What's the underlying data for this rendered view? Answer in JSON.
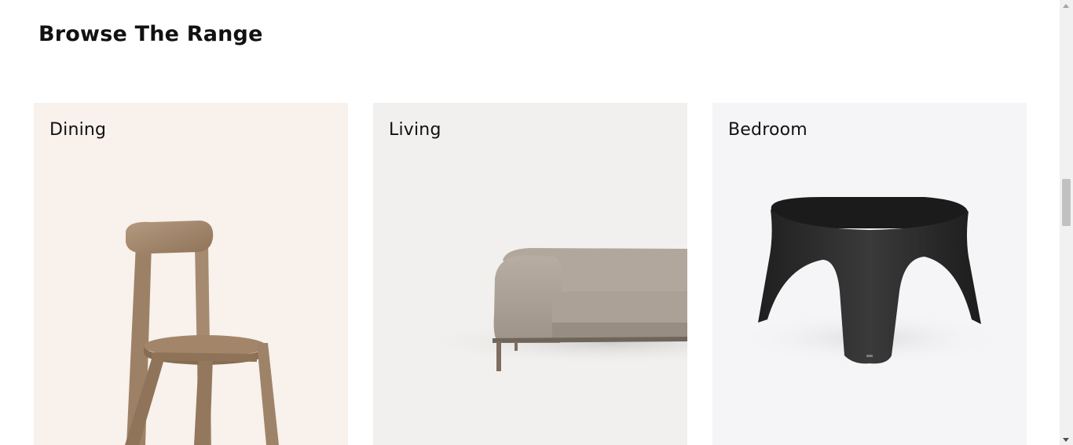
{
  "section": {
    "title": "Browse The Range"
  },
  "categories": [
    {
      "label": "Dining",
      "image": "wooden-chair-image",
      "bg": "#f8f1ec"
    },
    {
      "label": "Living",
      "image": "sofa-image",
      "bg": "#f1f0ef"
    },
    {
      "label": "Bedroom",
      "image": "black-side-table-image",
      "bg": "#f5f5f7"
    }
  ]
}
